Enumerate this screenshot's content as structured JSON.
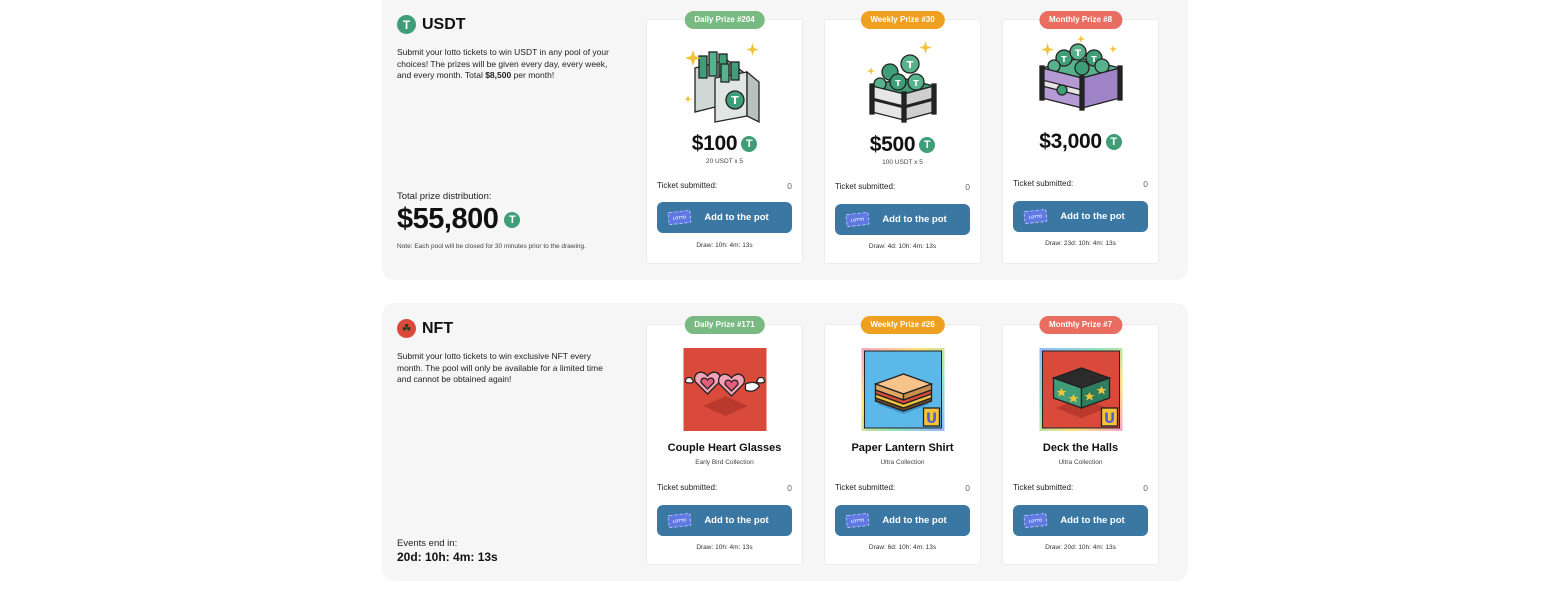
{
  "usdt": {
    "title": "USDT",
    "coin_glyph": "T",
    "description_pre": "Submit your lotto tickets to win USDT in any pool of your choices! The prizes will be given every day, every week, and every month. Total ",
    "description_bold": "$8,500",
    "description_post": " per month!",
    "total_label": "Total prize distribution:",
    "total_value": "$55,800",
    "note": "Note: Each pool will be closed for 30 minutes prior to the drawing.",
    "cards": [
      {
        "badge": "Daily Prize #204",
        "badge_color": "#79b982",
        "prize": "$100",
        "sub": "20 USDT x 5",
        "ticket_label": "Ticket submitted:",
        "ticket_count": "0",
        "button": "Add to the pot",
        "draw": "Draw: 10h: 4m: 13s",
        "art": "money-bags-icon"
      },
      {
        "badge": "Weekly Prize #30",
        "badge_color": "#efa021",
        "prize": "$500",
        "sub": "100 USDT x 5",
        "ticket_label": "Ticket submitted:",
        "ticket_count": "0",
        "button": "Add to the pot",
        "draw": "Draw: 4d: 10h: 4m: 13s",
        "art": "coin-crate-icon"
      },
      {
        "badge": "Monthly Prize #8",
        "badge_color": "#ea6d62",
        "prize": "$3,000",
        "sub": "",
        "ticket_label": "Ticket submitted:",
        "ticket_count": "0",
        "button": "Add to the pot",
        "draw": "Draw: 23d: 10h: 4m: 13s",
        "art": "treasure-chest-icon"
      }
    ]
  },
  "nft": {
    "title": "NFT",
    "description": "Submit your lotto tickets to win exclusive NFT every month. The pool will only be available for a limited time and cannot be obtained again!",
    "events_label": "Events end in:",
    "events_value": "20d: 10h: 4m: 13s",
    "cards": [
      {
        "badge": "Daily Prize #171",
        "badge_color": "#79b982",
        "name": "Couple Heart Glasses",
        "collection": "Early Bird Collection",
        "ticket_label": "Ticket submitted:",
        "ticket_count": "0",
        "button": "Add to the pot",
        "draw": "Draw: 10h: 4m: 13s",
        "art": "heart-glasses-icon"
      },
      {
        "badge": "Weekly Prize #26",
        "badge_color": "#efa021",
        "name": "Paper Lantern Shirt",
        "collection": "Ultra Collection",
        "ticket_label": "Ticket submitted:",
        "ticket_count": "0",
        "button": "Add to the pot",
        "draw": "Draw: 6d: 10h: 4m: 13s",
        "art": "lantern-shirt-icon"
      },
      {
        "badge": "Monthly Prize #7",
        "badge_color": "#ea6d62",
        "name": "Deck the Halls",
        "collection": "Ultra Collection",
        "ticket_label": "Ticket submitted:",
        "ticket_count": "0",
        "button": "Add to the pot",
        "draw": "Draw: 20d: 10h: 4m: 13s",
        "art": "deck-halls-icon"
      }
    ]
  },
  "ticket_icon_text": "LOTTO"
}
